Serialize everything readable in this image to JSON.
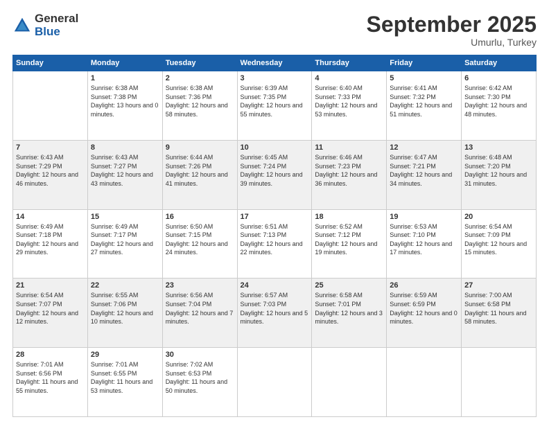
{
  "header": {
    "logo_line1": "General",
    "logo_line2": "Blue",
    "month": "September 2025",
    "location": "Umurlu, Turkey"
  },
  "days_of_week": [
    "Sunday",
    "Monday",
    "Tuesday",
    "Wednesday",
    "Thursday",
    "Friday",
    "Saturday"
  ],
  "weeks": [
    [
      {
        "day": "",
        "sunrise": "",
        "sunset": "",
        "daylight": ""
      },
      {
        "day": "1",
        "sunrise": "Sunrise: 6:38 AM",
        "sunset": "Sunset: 7:38 PM",
        "daylight": "Daylight: 13 hours and 0 minutes."
      },
      {
        "day": "2",
        "sunrise": "Sunrise: 6:38 AM",
        "sunset": "Sunset: 7:36 PM",
        "daylight": "Daylight: 12 hours and 58 minutes."
      },
      {
        "day": "3",
        "sunrise": "Sunrise: 6:39 AM",
        "sunset": "Sunset: 7:35 PM",
        "daylight": "Daylight: 12 hours and 55 minutes."
      },
      {
        "day": "4",
        "sunrise": "Sunrise: 6:40 AM",
        "sunset": "Sunset: 7:33 PM",
        "daylight": "Daylight: 12 hours and 53 minutes."
      },
      {
        "day": "5",
        "sunrise": "Sunrise: 6:41 AM",
        "sunset": "Sunset: 7:32 PM",
        "daylight": "Daylight: 12 hours and 51 minutes."
      },
      {
        "day": "6",
        "sunrise": "Sunrise: 6:42 AM",
        "sunset": "Sunset: 7:30 PM",
        "daylight": "Daylight: 12 hours and 48 minutes."
      }
    ],
    [
      {
        "day": "7",
        "sunrise": "Sunrise: 6:43 AM",
        "sunset": "Sunset: 7:29 PM",
        "daylight": "Daylight: 12 hours and 46 minutes."
      },
      {
        "day": "8",
        "sunrise": "Sunrise: 6:43 AM",
        "sunset": "Sunset: 7:27 PM",
        "daylight": "Daylight: 12 hours and 43 minutes."
      },
      {
        "day": "9",
        "sunrise": "Sunrise: 6:44 AM",
        "sunset": "Sunset: 7:26 PM",
        "daylight": "Daylight: 12 hours and 41 minutes."
      },
      {
        "day": "10",
        "sunrise": "Sunrise: 6:45 AM",
        "sunset": "Sunset: 7:24 PM",
        "daylight": "Daylight: 12 hours and 39 minutes."
      },
      {
        "day": "11",
        "sunrise": "Sunrise: 6:46 AM",
        "sunset": "Sunset: 7:23 PM",
        "daylight": "Daylight: 12 hours and 36 minutes."
      },
      {
        "day": "12",
        "sunrise": "Sunrise: 6:47 AM",
        "sunset": "Sunset: 7:21 PM",
        "daylight": "Daylight: 12 hours and 34 minutes."
      },
      {
        "day": "13",
        "sunrise": "Sunrise: 6:48 AM",
        "sunset": "Sunset: 7:20 PM",
        "daylight": "Daylight: 12 hours and 31 minutes."
      }
    ],
    [
      {
        "day": "14",
        "sunrise": "Sunrise: 6:49 AM",
        "sunset": "Sunset: 7:18 PM",
        "daylight": "Daylight: 12 hours and 29 minutes."
      },
      {
        "day": "15",
        "sunrise": "Sunrise: 6:49 AM",
        "sunset": "Sunset: 7:17 PM",
        "daylight": "Daylight: 12 hours and 27 minutes."
      },
      {
        "day": "16",
        "sunrise": "Sunrise: 6:50 AM",
        "sunset": "Sunset: 7:15 PM",
        "daylight": "Daylight: 12 hours and 24 minutes."
      },
      {
        "day": "17",
        "sunrise": "Sunrise: 6:51 AM",
        "sunset": "Sunset: 7:13 PM",
        "daylight": "Daylight: 12 hours and 22 minutes."
      },
      {
        "day": "18",
        "sunrise": "Sunrise: 6:52 AM",
        "sunset": "Sunset: 7:12 PM",
        "daylight": "Daylight: 12 hours and 19 minutes."
      },
      {
        "day": "19",
        "sunrise": "Sunrise: 6:53 AM",
        "sunset": "Sunset: 7:10 PM",
        "daylight": "Daylight: 12 hours and 17 minutes."
      },
      {
        "day": "20",
        "sunrise": "Sunrise: 6:54 AM",
        "sunset": "Sunset: 7:09 PM",
        "daylight": "Daylight: 12 hours and 15 minutes."
      }
    ],
    [
      {
        "day": "21",
        "sunrise": "Sunrise: 6:54 AM",
        "sunset": "Sunset: 7:07 PM",
        "daylight": "Daylight: 12 hours and 12 minutes."
      },
      {
        "day": "22",
        "sunrise": "Sunrise: 6:55 AM",
        "sunset": "Sunset: 7:06 PM",
        "daylight": "Daylight: 12 hours and 10 minutes."
      },
      {
        "day": "23",
        "sunrise": "Sunrise: 6:56 AM",
        "sunset": "Sunset: 7:04 PM",
        "daylight": "Daylight: 12 hours and 7 minutes."
      },
      {
        "day": "24",
        "sunrise": "Sunrise: 6:57 AM",
        "sunset": "Sunset: 7:03 PM",
        "daylight": "Daylight: 12 hours and 5 minutes."
      },
      {
        "day": "25",
        "sunrise": "Sunrise: 6:58 AM",
        "sunset": "Sunset: 7:01 PM",
        "daylight": "Daylight: 12 hours and 3 minutes."
      },
      {
        "day": "26",
        "sunrise": "Sunrise: 6:59 AM",
        "sunset": "Sunset: 6:59 PM",
        "daylight": "Daylight: 12 hours and 0 minutes."
      },
      {
        "day": "27",
        "sunrise": "Sunrise: 7:00 AM",
        "sunset": "Sunset: 6:58 PM",
        "daylight": "Daylight: 11 hours and 58 minutes."
      }
    ],
    [
      {
        "day": "28",
        "sunrise": "Sunrise: 7:01 AM",
        "sunset": "Sunset: 6:56 PM",
        "daylight": "Daylight: 11 hours and 55 minutes."
      },
      {
        "day": "29",
        "sunrise": "Sunrise: 7:01 AM",
        "sunset": "Sunset: 6:55 PM",
        "daylight": "Daylight: 11 hours and 53 minutes."
      },
      {
        "day": "30",
        "sunrise": "Sunrise: 7:02 AM",
        "sunset": "Sunset: 6:53 PM",
        "daylight": "Daylight: 11 hours and 50 minutes."
      },
      {
        "day": "",
        "sunrise": "",
        "sunset": "",
        "daylight": ""
      },
      {
        "day": "",
        "sunrise": "",
        "sunset": "",
        "daylight": ""
      },
      {
        "day": "",
        "sunrise": "",
        "sunset": "",
        "daylight": ""
      },
      {
        "day": "",
        "sunrise": "",
        "sunset": "",
        "daylight": ""
      }
    ]
  ]
}
